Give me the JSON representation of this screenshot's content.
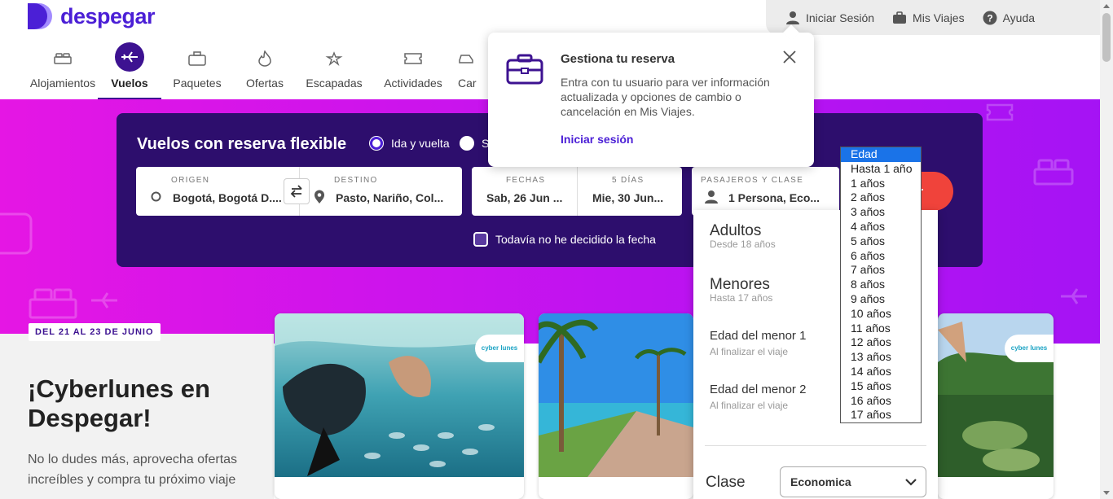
{
  "brand": {
    "name": "despegar",
    "color": "#4b1fd6"
  },
  "user_menu": {
    "login": "Iniciar Sesión",
    "trips": "Mis Viajes",
    "help": "Ayuda"
  },
  "nav": [
    {
      "label": "Alojamientos",
      "icon": "bed-icon"
    },
    {
      "label": "Vuelos",
      "icon": "plane-icon",
      "active": true
    },
    {
      "label": "Paquetes",
      "icon": "suitcase-icon"
    },
    {
      "label": "Ofertas",
      "icon": "fire-icon"
    },
    {
      "label": "Escapadas",
      "icon": "plane-star-icon"
    },
    {
      "label": "Actividades",
      "icon": "ticket-icon"
    },
    {
      "label": "Car",
      "icon": "car-icon"
    }
  ],
  "popup": {
    "title": "Gestiona tu reserva",
    "text": "Entra con tu usuario para ver información actualizada y opciones de cambio o cancelación en Mis Viajes.",
    "link": "Iniciar sesión"
  },
  "search": {
    "title": "Vuelos con reserva flexible",
    "trip_type_1": "Ida y vuelta",
    "trip_type_2": "S",
    "origin_label": "ORIGEN",
    "origin_value": "Bogotá, Bogotá D....",
    "destination_label": "DESTINO",
    "destination_value": "Pasto, Nariño, Col...",
    "dates_label": "FECHAS",
    "date_from": "Sab, 26 Jun ...",
    "days_label": "5 DÍAS",
    "date_to": "Mie, 30 Jun...",
    "pax_label": "PASAJEROS Y CLASE",
    "pax_value": "1 Persona, Eco...",
    "undecided": "Todavía no he decidido la fecha",
    "search_button": "ar"
  },
  "pax_panel": {
    "adults": "Adultos",
    "adults_sub": "Desde 18 años",
    "minors": "Menores",
    "minors_sub": "Hasta 17 años",
    "minor1": "Edad del menor 1",
    "minor1_sub": "Al finalizar el viaje",
    "minor2": "Edad del menor 2",
    "minor2_sub": "Al finalizar el viaje",
    "class_label": "Clase",
    "class_value": "Economica"
  },
  "age_options": [
    "Edad",
    "Hasta 1 año",
    "1 años",
    "2 años",
    "3 años",
    "4 años",
    "5 años",
    "6 años",
    "7 años",
    "8 años",
    "9 años",
    "10 años",
    "11 años",
    "12 años",
    "13 años",
    "14 años",
    "15 años",
    "16 años",
    "17 años"
  ],
  "promo": {
    "badge": "DEL 21 AL 23 DE JUNIO",
    "title": "¡Cyberlunes en Despegar!",
    "text": "No lo dudes más, aprovecha ofertas increíbles y compra tu próximo viaje"
  },
  "card_logo": "cyber lunes",
  "colors": {
    "hero": "#c013f0",
    "searchbox": "#2d0e6d",
    "accent": "#f0433b"
  }
}
